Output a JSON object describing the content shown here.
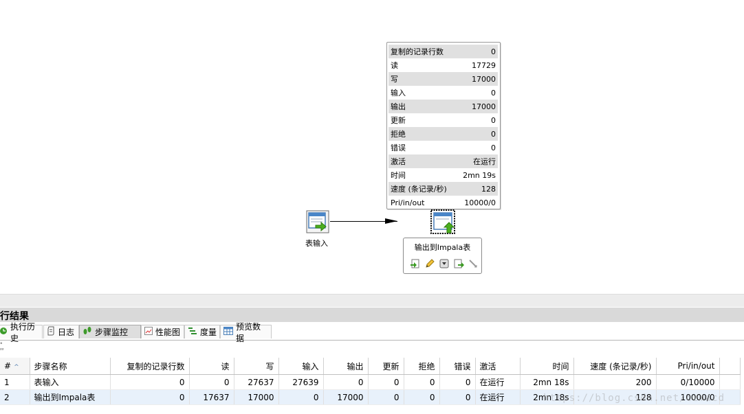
{
  "popup": {
    "rows": [
      {
        "label": "复制的记录行数",
        "value": "0"
      },
      {
        "label": "读",
        "value": "17729"
      },
      {
        "label": "写",
        "value": "17000"
      },
      {
        "label": "输入",
        "value": "0"
      },
      {
        "label": "输出",
        "value": "17000"
      },
      {
        "label": "更新",
        "value": "0"
      },
      {
        "label": "拒绝",
        "value": "0"
      },
      {
        "label": "错误",
        "value": "0"
      },
      {
        "label": "激活",
        "value": "在运行"
      },
      {
        "label": "时间",
        "value": "2mn 19s"
      },
      {
        "label": "速度 (条记录/秒)",
        "value": "128"
      },
      {
        "label": "Pri/in/out",
        "value": "10000/0"
      }
    ]
  },
  "steps": {
    "input_label": "表输入",
    "output_label": "输出到Impala表"
  },
  "panel": {
    "title": "行结果",
    "tabs": [
      {
        "label": "执行历史",
        "icon": "history-icon"
      },
      {
        "label": "日志",
        "icon": "log-icon"
      },
      {
        "label": "步骤监控",
        "icon": "footsteps-icon"
      },
      {
        "label": "性能图",
        "icon": "chart-icon"
      },
      {
        "label": "度量",
        "icon": "metrics-icon"
      },
      {
        "label": "预览数据",
        "icon": "table-icon"
      }
    ],
    "active_tab": "步骤监控",
    "tiny_marks": [
      "°",
      "²²"
    ]
  },
  "table": {
    "columns": [
      "#",
      "步骤名称",
      "复制的记录行数",
      "读",
      "写",
      "输入",
      "输出",
      "更新",
      "拒绝",
      "错误",
      "激活",
      "时间",
      "速度 (条记录/秒)",
      "Pri/in/out"
    ],
    "rows": [
      [
        "1",
        "表输入",
        "0",
        "0",
        "27637",
        "27639",
        "0",
        "0",
        "0",
        "0",
        "在运行",
        "2mn 18s",
        "200",
        "0/10000"
      ],
      [
        "2",
        "输出到Impala表",
        "0",
        "17637",
        "17000",
        "0",
        "17000",
        "0",
        "0",
        "0",
        "在运行",
        "2mn 18s",
        "128",
        "10000/0"
      ]
    ]
  },
  "watermark": "https://blog.csdn.net/czmacd"
}
